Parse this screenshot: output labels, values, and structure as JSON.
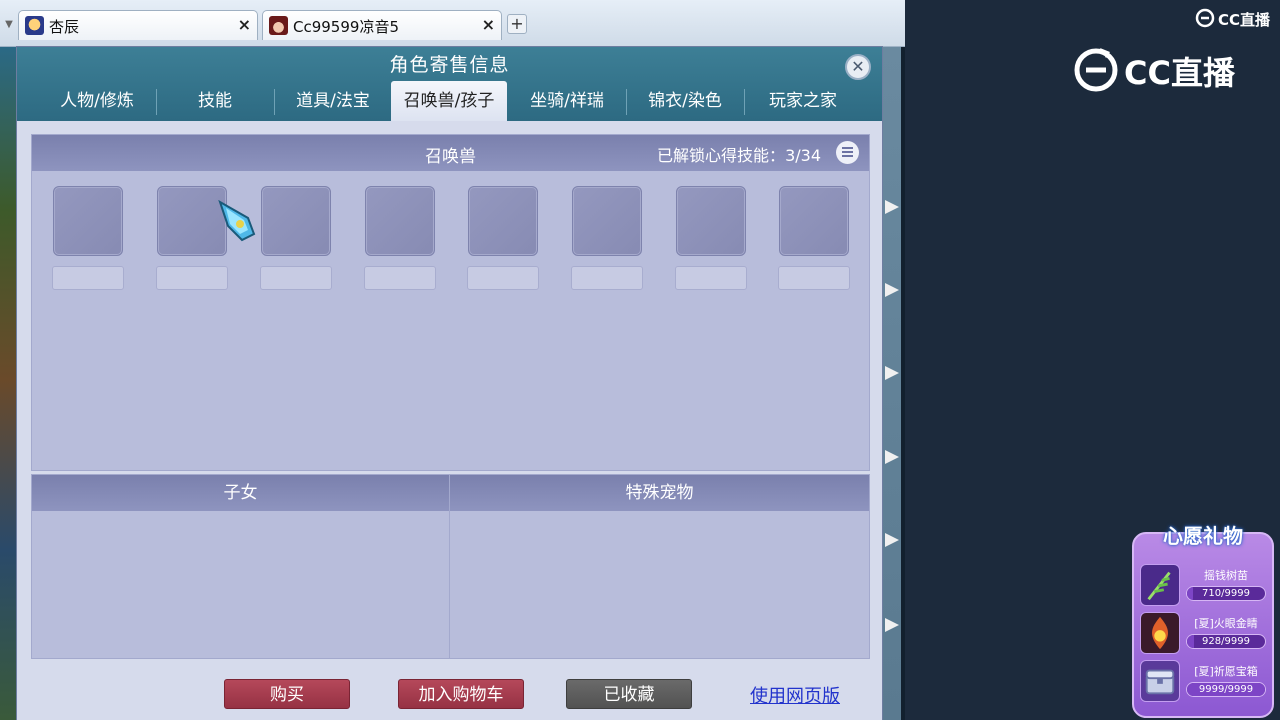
{
  "browser": {
    "tabs": [
      {
        "label": "杏辰",
        "close": "×"
      },
      {
        "label": "Cc99599凉音5",
        "close": "×"
      }
    ],
    "new_tab": "+"
  },
  "dialog": {
    "title": "角色寄售信息",
    "close": "✕",
    "tabs": [
      "人物/修炼",
      "技能",
      "道具/法宝",
      "召唤兽/孩子",
      "坐骑/祥瑞",
      "锦衣/染色",
      "玩家之家"
    ],
    "active_tab": 3,
    "pets": {
      "title": "召唤兽",
      "unlock_label": "已解锁心得技能：",
      "unlock_value": "3/34"
    },
    "children": {
      "title": "子女"
    },
    "special_pets": {
      "title": "特殊宠物"
    },
    "buttons": {
      "buy": "购买",
      "add_cart": "加入购物车",
      "favorited": "已收藏",
      "web_link": "使用网页版"
    }
  },
  "brand": {
    "small": "CC直播",
    "large": "CC直播"
  },
  "wish": {
    "title": "心愿礼物",
    "items": [
      {
        "name": "摇钱树苗",
        "count": "710/9999",
        "progress": 0.071
      },
      {
        "name": "[夏]火眼金睛",
        "count": "928/9999",
        "progress": 0.093
      },
      {
        "name": "[夏]祈愿宝箱",
        "count": "9999/9999",
        "progress": 1.0
      }
    ]
  },
  "colors": {
    "dialog_header": "#3d7f96",
    "panel": "#b8bddb",
    "button_red": "#a83e50",
    "button_gray": "#5e5e5e",
    "wish_purple": "#9a66d8"
  }
}
